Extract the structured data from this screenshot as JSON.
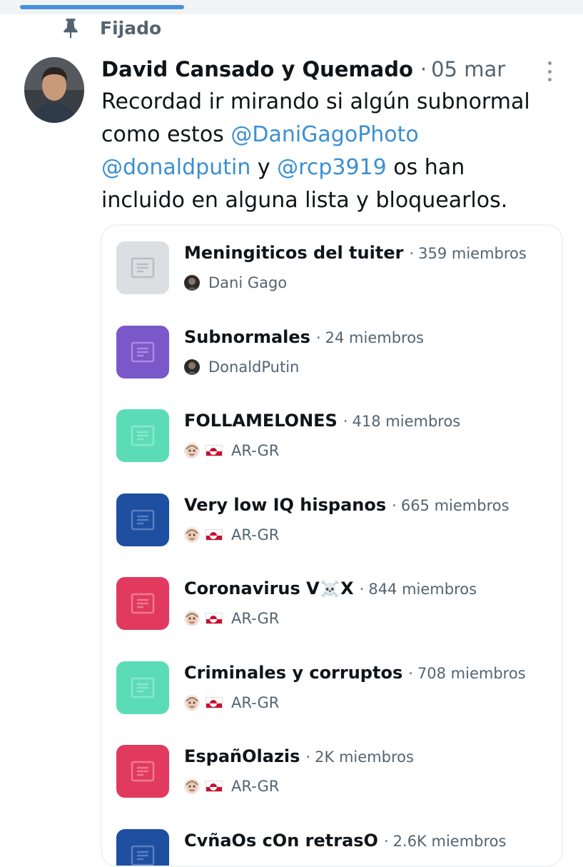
{
  "pinned": {
    "label": "Fijado",
    "icon": "pin-icon"
  },
  "tweet": {
    "author": "David Cansado y Quemado",
    "separator": "·",
    "date": "05 mar",
    "text": {
      "line1": "Recordad ir mirando si algún subnormal",
      "line2_prefix": "como estos ",
      "mention1": "@DaniGagoPhoto",
      "mention2": "@donaldputin",
      "connector": " y ",
      "mention3": "@rcp3919",
      "line3_suffix": " os han",
      "line4": "incluido en alguna lista y bloquearlos."
    }
  },
  "lists": [
    {
      "name": "Meningiticos del tuiter",
      "members": "359 miembros",
      "owner": "Dani Gago",
      "color": "#dcdfe2",
      "icon_color": "#b8bec4",
      "owner_avatar": "dark-person",
      "flag": false
    },
    {
      "name": "Subnormales",
      "members": "24 miembros",
      "owner": "DonaldPutin",
      "color": "#7a58c9",
      "icon_color": "#a68cde",
      "owner_avatar": "dark-person",
      "flag": false
    },
    {
      "name": "FOLLAMELONES",
      "members": "418 miembros",
      "owner": "AR-GR",
      "color": "#5cdcb6",
      "icon_color": "#8be8cc",
      "owner_avatar": "face",
      "flag": true
    },
    {
      "name": "Very low IQ hispanos",
      "members": "665 miembros",
      "owner": "AR-GR",
      "color": "#1f4fa0",
      "icon_color": "#5a7fc0",
      "owner_avatar": "face",
      "flag": true
    },
    {
      "name_prefix": "Coronavirus V",
      "name_skull": "☠️",
      "name_suffix": "X",
      "members": "844 miembros",
      "owner": "AR-GR",
      "color": "#e13a5e",
      "icon_color": "#ee7a93",
      "owner_avatar": "face",
      "flag": true
    },
    {
      "name": "Criminales y corruptos",
      "members": "708 miembros",
      "owner": "AR-GR",
      "color": "#5cdcb6",
      "icon_color": "#8be8cc",
      "owner_avatar": "face",
      "flag": true
    },
    {
      "name": "EspañOlazis",
      "members": "2K miembros",
      "owner": "AR-GR",
      "color": "#e13a5e",
      "icon_color": "#ee7a93",
      "owner_avatar": "face",
      "flag": true
    },
    {
      "name": "CvñaOs cOn retrasO",
      "members": "2.6K miembros",
      "owner": "",
      "color": "#1f4fa0",
      "icon_color": "#5a7fc0",
      "owner_avatar": "",
      "flag": false
    }
  ],
  "more_menu_icon": "more-vertical-icon"
}
